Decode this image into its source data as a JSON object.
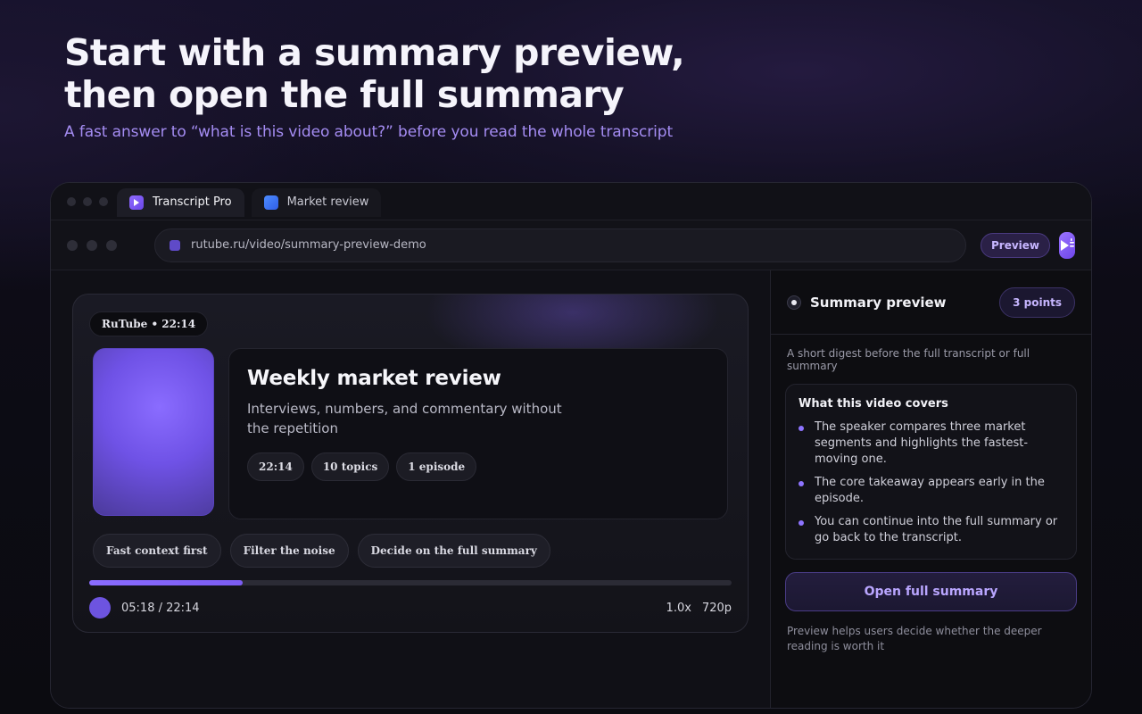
{
  "hero": {
    "title": "Start with a summary preview, then open the full summary",
    "subtitle": "A fast answer to “what is this video about?” before you read the whole transcript"
  },
  "tabs": [
    {
      "label": "Transcript Pro",
      "icon": "play-icon",
      "color": "#8f6bff"
    },
    {
      "label": "Market review",
      "icon": "square-icon",
      "color": "#4d8cff"
    }
  ],
  "address": {
    "url": "rutube.ru/video/summary-preview-demo",
    "preview_label": "Preview"
  },
  "player": {
    "source_chip": "RuTube • 22:14",
    "title": "Weekly market review",
    "subtitle": "Interviews, numbers, and commentary without the repetition",
    "stats": [
      "22:14",
      "10 topics",
      "1 episode"
    ],
    "features": [
      "Fast context first",
      "Filter the noise",
      "Decide on the full summary"
    ],
    "progress_fraction": 0.239,
    "time": "05:18 / 22:14",
    "speed": "1.0x",
    "quality": "720p"
  },
  "panel": {
    "title": "Summary preview",
    "points_label": "3 points",
    "digest": "A short digest before the full transcript or full summary",
    "covers_title": "What this video covers",
    "bullets": [
      "The speaker compares three market segments and highlights the fastest-moving one.",
      "The core takeaway appears early in the episode.",
      "You can continue into the full summary or go back to the transcript."
    ],
    "open_button": "Open full summary",
    "hint": "Preview helps users decide whether the deeper reading is worth it"
  },
  "colors": {
    "accent": "#8a6cff",
    "accent_text": "#a48cf2"
  }
}
